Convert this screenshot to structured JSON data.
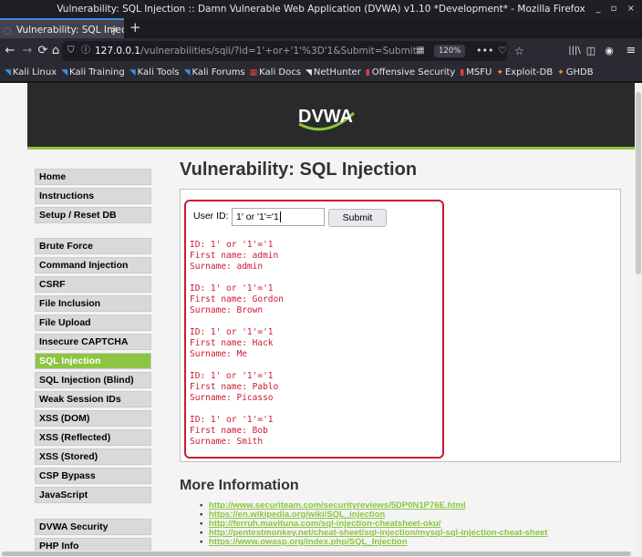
{
  "window": {
    "title": "Vulnerability: SQL Injection :: Damn Vulnerable Web Application (DVWA) v1.10 *Development* - Mozilla Firefox",
    "controls": "_ ▫ ×"
  },
  "tab": {
    "label": "Vulnerability: SQL Injectio",
    "close": "×",
    "new_tab": "+"
  },
  "nav": {
    "back": "←",
    "forward": "→",
    "reload": "⟳",
    "home": "⌂",
    "url_host": "127.0.0.1",
    "url_path": "/vulnerabilities/sqli/?id=1'+or+'1'%3D'1&Submit=Submit#",
    "zoom": "120%",
    "library": "|||\\",
    "menu": "≡"
  },
  "bookmarks": [
    {
      "label": "Kali Linux",
      "icon": "kali-icon",
      "glyph": "◥",
      "color": "#3a8ee6"
    },
    {
      "label": "Kali Training",
      "icon": "kali-icon",
      "glyph": "◥",
      "color": "#3a8ee6"
    },
    {
      "label": "Kali Tools",
      "icon": "kali-icon",
      "glyph": "◥",
      "color": "#3a8ee6"
    },
    {
      "label": "Kali Forums",
      "icon": "kali-icon",
      "glyph": "◥",
      "color": "#3a8ee6"
    },
    {
      "label": "Kali Docs",
      "icon": "docs-icon",
      "glyph": "▦",
      "color": "#e04040"
    },
    {
      "label": "NetHunter",
      "icon": "nethunter-icon",
      "glyph": "◥",
      "color": "#e6e6e6"
    },
    {
      "label": "Offensive Security",
      "icon": "offsec-icon",
      "glyph": "▮",
      "color": "#e04040"
    },
    {
      "label": "MSFU",
      "icon": "offsec-icon",
      "glyph": "▮",
      "color": "#e04040"
    },
    {
      "label": "Exploit-DB",
      "icon": "exploitdb-icon",
      "glyph": "✦",
      "color": "#e89b2c"
    },
    {
      "label": "GHDB",
      "icon": "exploitdb-icon",
      "glyph": "✦",
      "color": "#e89b2c"
    }
  ],
  "logo_text": "DVWA",
  "menu": {
    "items": [
      {
        "label": "Home",
        "active": false
      },
      {
        "label": "Instructions",
        "active": false
      },
      {
        "label": "Setup / Reset DB",
        "active": false
      },
      {
        "label": "Brute Force",
        "active": false
      },
      {
        "label": "Command Injection",
        "active": false
      },
      {
        "label": "CSRF",
        "active": false
      },
      {
        "label": "File Inclusion",
        "active": false
      },
      {
        "label": "File Upload",
        "active": false
      },
      {
        "label": "Insecure CAPTCHA",
        "active": false
      },
      {
        "label": "SQL Injection",
        "active": true
      },
      {
        "label": "SQL Injection (Blind)",
        "active": false
      },
      {
        "label": "Weak Session IDs",
        "active": false
      },
      {
        "label": "XSS (DOM)",
        "active": false
      },
      {
        "label": "XSS (Reflected)",
        "active": false
      },
      {
        "label": "XSS (Stored)",
        "active": false
      },
      {
        "label": "CSP Bypass",
        "active": false
      },
      {
        "label": "JavaScript",
        "active": false
      },
      {
        "label": "DVWA Security",
        "active": false
      },
      {
        "label": "PHP Info",
        "active": false
      }
    ]
  },
  "main": {
    "title": "Vulnerability: SQL Injection",
    "form": {
      "label": "User ID:",
      "value": "1' or '1'='1",
      "submit": "Submit"
    },
    "results": [
      "ID: 1' or '1'='1\nFirst name: admin\nSurname: admin",
      "ID: 1' or '1'='1\nFirst name: Gordon\nSurname: Brown",
      "ID: 1' or '1'='1\nFirst name: Hack\nSurname: Me",
      "ID: 1' or '1'='1\nFirst name: Pablo\nSurname: Picasso",
      "ID: 1' or '1'='1\nFirst name: Bob\nSurname: Smith"
    ],
    "more_info_title": "More Information",
    "links": [
      "http://www.securiteam.com/securityreviews/5DP0N1P76E.html",
      "https://en.wikipedia.org/wiki/SQL_injection",
      "http://ferruh.mavituna.com/sql-injection-cheatsheet-oku/",
      "http://pentestmonkey.net/cheat-sheet/sql-injection/mysql-sql-injection-cheat-sheet",
      "https://www.owasp.org/index.php/SQL_Injection"
    ]
  },
  "colors": {
    "accent_green": "#8cc540",
    "result_red": "#cc1a2e",
    "header_dark": "#2a2a2a"
  }
}
